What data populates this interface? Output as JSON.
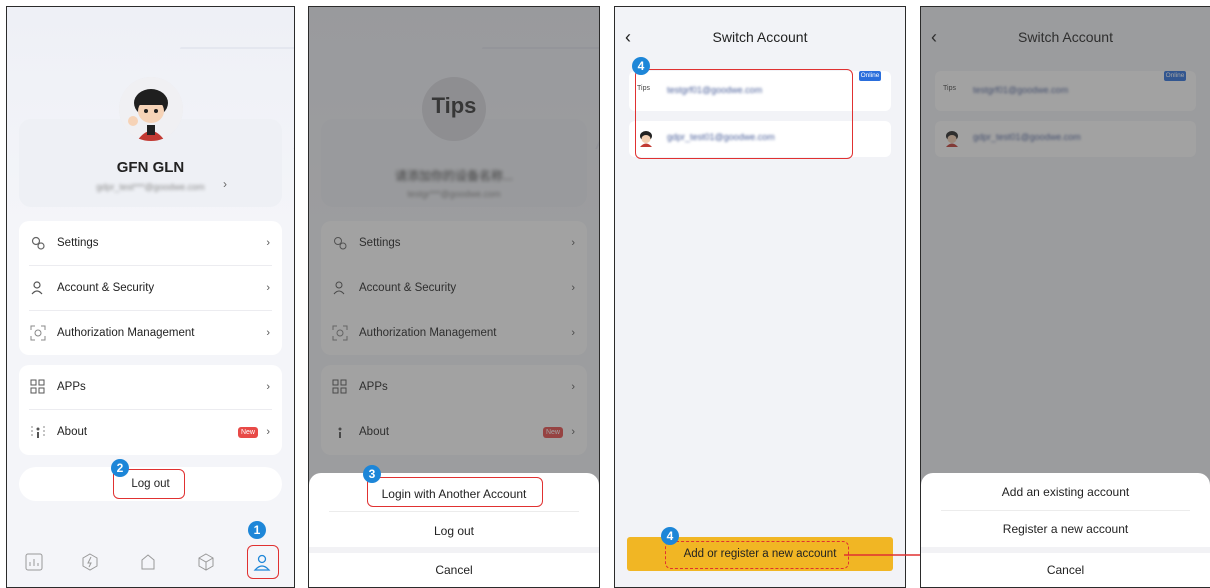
{
  "screen1": {
    "profile": {
      "name": "GFN GLN",
      "email": "gdpr_test***@goodwe.com"
    },
    "menu_group1": [
      {
        "label": "Settings",
        "icon": "settings-gear-icon"
      },
      {
        "label": "Account & Security",
        "icon": "user-icon"
      },
      {
        "label": "Authorization Management",
        "icon": "face-scan-icon"
      }
    ],
    "menu_group2": [
      {
        "label": "APPs",
        "icon": "apps-grid-icon"
      },
      {
        "label": "About",
        "icon": "info-icon",
        "badge": "New"
      }
    ],
    "logout_label": "Log out",
    "tabs": [
      "chart-icon",
      "bolt-icon",
      "home-icon",
      "box-icon",
      "profile-icon"
    ],
    "step1": "1",
    "step2": "2"
  },
  "screen2": {
    "tips_title": "Tips",
    "blurred_title": "请添加你的设备名称...",
    "blurred_email": "testgr***@goodwe.com",
    "menu_group1": [
      {
        "label": "Settings"
      },
      {
        "label": "Account & Security"
      },
      {
        "label": "Authorization Management"
      }
    ],
    "menu_group2": [
      {
        "label": "APPs"
      },
      {
        "label": "About",
        "badge": "New"
      }
    ],
    "sheet": {
      "login_another": "Login with Another Account",
      "logout": "Log out",
      "cancel": "Cancel"
    },
    "step3": "3"
  },
  "screen3": {
    "title": "Switch Account",
    "accounts": [
      {
        "label": "Tips",
        "email": "testgrf01@goodwe.com",
        "status": "Online"
      },
      {
        "label": "",
        "email": "gdpr_test01@goodwe.com"
      }
    ],
    "add_button": "Add or register a new account",
    "step4a": "4",
    "step4b": "4"
  },
  "screen4": {
    "title": "Switch Account",
    "accounts": [
      {
        "label": "Tips",
        "email": "testgrf01@goodwe.com",
        "status": "Online"
      },
      {
        "label": "",
        "email": "gdpr_test01@goodwe.com"
      }
    ],
    "sheet": {
      "add_existing": "Add an existing account",
      "register_new": "Register a new account",
      "cancel": "Cancel"
    }
  },
  "colors": {
    "accent_red": "#e03131",
    "step_blue": "#1d86d8",
    "button_yellow": "#f1b624",
    "online_blue": "#2a6edc"
  }
}
